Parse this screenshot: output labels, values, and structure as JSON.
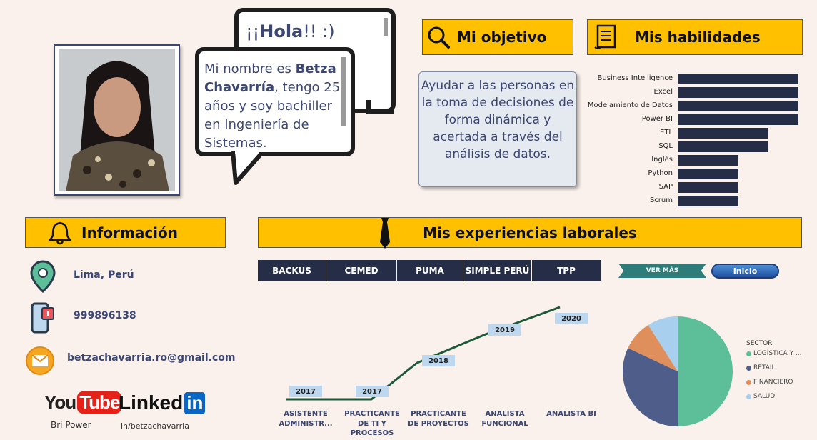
{
  "profile": {
    "greeting_prefix": "¡¡",
    "greeting_word": "Hola",
    "greeting_suffix": "!!  :)",
    "intro_before": "Mi nombre es ",
    "intro_name": "Betza Chavarría",
    "intro_after": ", tengo 25 años y soy bachiller en Ingeniería de Sistemas."
  },
  "objective": {
    "title": "Mi objetivo",
    "text": "Ayudar a las personas en la toma de decisiones de forma dinámica y acertada a través del análisis de datos."
  },
  "skills": {
    "title": "Mis habilidades",
    "items": [
      {
        "label": "Business Intelligence",
        "level": 1.0
      },
      {
        "label": "Excel",
        "level": 1.0
      },
      {
        "label": "Modelamiento de Datos",
        "level": 1.0
      },
      {
        "label": "Power BI",
        "level": 1.0
      },
      {
        "label": "ETL",
        "level": 0.75
      },
      {
        "label": "SQL",
        "level": 0.75
      },
      {
        "label": "Inglés",
        "level": 0.5
      },
      {
        "label": "Python",
        "level": 0.5
      },
      {
        "label": "SAP",
        "level": 0.5
      },
      {
        "label": "Scrum",
        "level": 0.5
      }
    ]
  },
  "info": {
    "title": "Información",
    "location": "Lima, Perú",
    "phone": "999896138",
    "email": "betzachavarria.ro@gmail.com",
    "youtube_word1": "You",
    "youtube_word2": "Tube",
    "youtube_caption": "Bri Power",
    "linkedin_word": "Linked",
    "linkedin_in": "in",
    "linkedin_caption": "in/betzachavarria"
  },
  "experience": {
    "title": "Mis experiencias laborales",
    "companies": [
      "BACKUS",
      "CEMED",
      "PUMA",
      "SIMPLE PERÚ",
      "TPP"
    ],
    "ver_mas": "VER MÁS",
    "inicio": "Inicio"
  },
  "timeline": {
    "years": [
      "2017",
      "2017",
      "2018",
      "2019",
      "2020"
    ],
    "jobs": [
      "ASISTENTE ADMINISTR...",
      "PRACTICANTE DE TI Y PROCESOS",
      "PRACTICANTE DE PROYECTOS",
      "ANALISTA FUNCIONAL",
      "ANALISTA BI"
    ]
  },
  "chart_data": {
    "type": "pie",
    "legend_title": "SECTOR",
    "legend_position": "right",
    "slices": [
      {
        "label": "LOGÍSTICA Y ...",
        "value": 50,
        "color": "#5DBE9A"
      },
      {
        "label": "RETAIL",
        "value": 32,
        "color": "#4F5D8A"
      },
      {
        "label": "FINANCIERO",
        "value": 9,
        "color": "#DE8F5B"
      },
      {
        "label": "SALUD",
        "value": 9,
        "color": "#A9CFEE"
      }
    ]
  },
  "colors": {
    "accent": "#FFC000",
    "navy": "#252D47",
    "background": "#FAF1EC",
    "timeline_line": "#1E5A3A"
  }
}
